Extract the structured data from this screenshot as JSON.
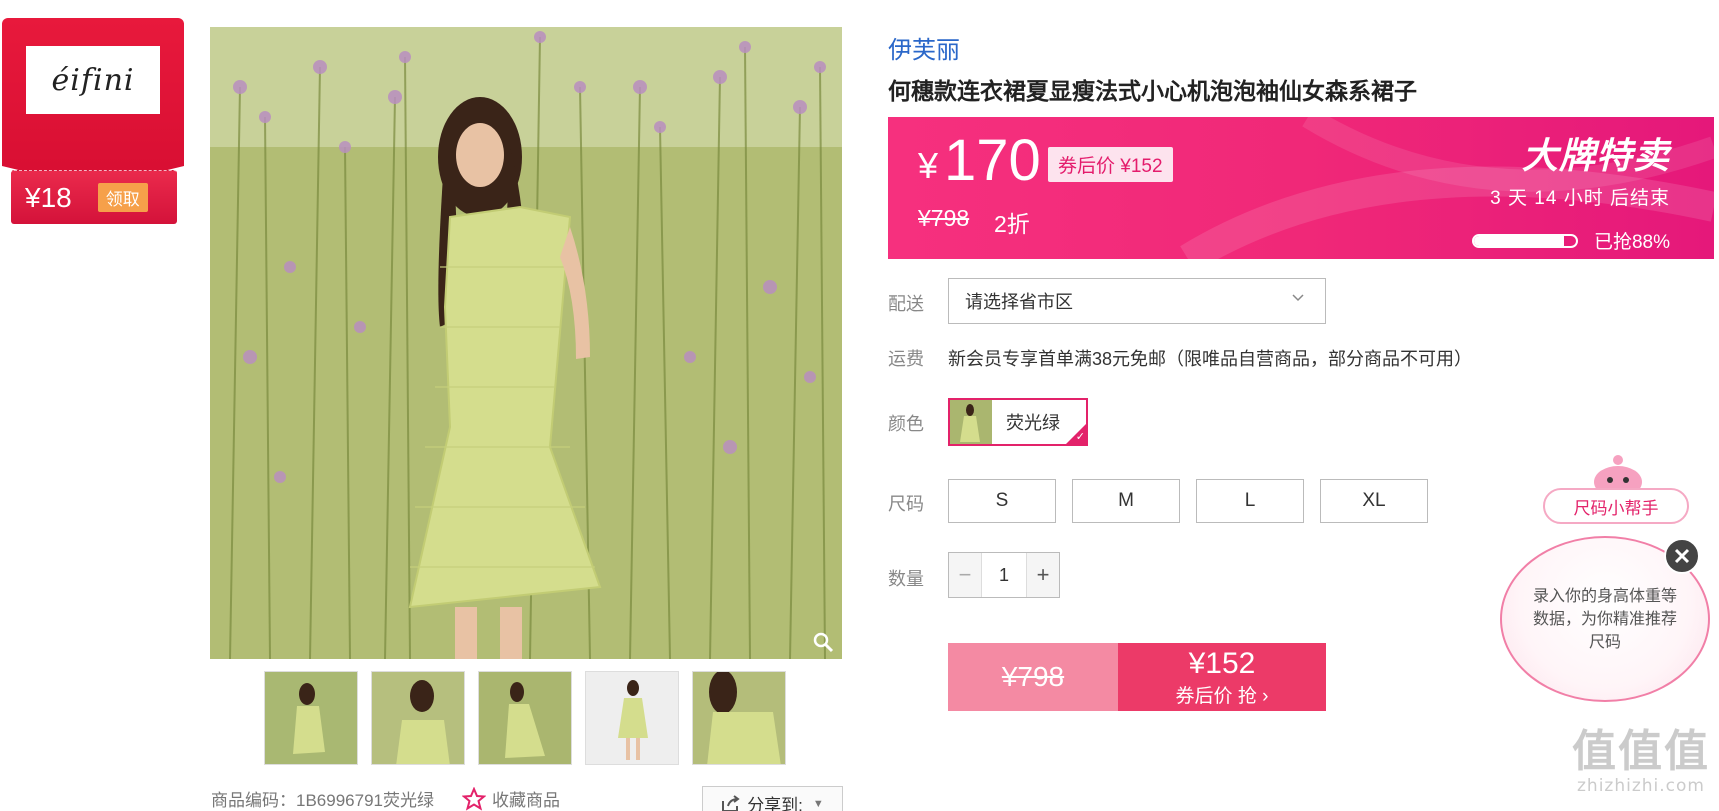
{
  "coupon": {
    "brand_logo_text": "éifini",
    "amount": "¥18",
    "claim_label": "领取"
  },
  "gallery": {
    "thumbnail_count": 5
  },
  "meta": {
    "sku_code": "商品编码：1B6996791荧光绿",
    "favorite_label": "收藏商品",
    "share_label": "分享到:"
  },
  "product": {
    "brand": "伊芙丽",
    "title": "何穗款连衣裙夏显瘦法式小心机泡泡袖仙女森系裙子"
  },
  "price_banner": {
    "yen_symbol": "¥",
    "current_price": "170",
    "after_coupon_tag": "券后价 ¥152",
    "original_price": "¥798",
    "discount": "2折",
    "sale_title": "大牌特卖",
    "countdown": "3 天 14 小时 后结束",
    "sold_progress": 0.88,
    "sold_text": "已抢88%"
  },
  "shipping": {
    "delivery_label": "配送",
    "address_placeholder": "请选择省市区",
    "fee_label": "运费",
    "fee_text": "新会员专享首单满38元免邮（限唯品自营商品，部分商品不可用）"
  },
  "options": {
    "color_label": "颜色",
    "color_value": "荧光绿",
    "size_label": "尺码",
    "sizes": [
      "S",
      "M",
      "L",
      "XL"
    ],
    "qty_label": "数量",
    "qty_value": "1",
    "qty_minus": "−",
    "qty_plus": "+"
  },
  "buy": {
    "original_price": "¥798",
    "price": "¥152",
    "cta": "券后价 抢 ›"
  },
  "size_helper": {
    "title": "尺码小帮手",
    "message": "录入你的身高体重等数据，为你精准推荐尺码"
  },
  "watermark": {
    "big": "值值值",
    "small": "zhizhizhi.com"
  },
  "colors": {
    "accent_pink": "#f02878",
    "coupon_red": "#d90f33",
    "buy_pink": "#ec3a68",
    "brand_blue": "#2a67c9"
  }
}
